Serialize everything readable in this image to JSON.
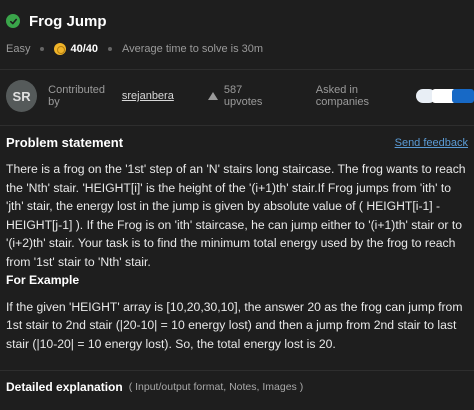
{
  "problem": {
    "title": "Frog Jump",
    "difficulty": "Easy",
    "score": "40/40",
    "avg_time": "Average time to solve is 30m"
  },
  "contributor": {
    "avatar_initials": "SR",
    "label": "Contributed by",
    "username": "srejanbera",
    "upvotes": "587 upvotes",
    "companies_label": "Asked in companies"
  },
  "statement": {
    "heading": "Problem statement",
    "feedback_link": "Send feedback",
    "body": "There is a frog on the '1st' step of an 'N' stairs long staircase. The frog wants to reach the 'Nth' stair. 'HEIGHT[i]' is the height of the '(i+1)th' stair.If Frog jumps from 'ith' to 'jth' stair, the energy lost in the jump is given by absolute value of ( HEIGHT[i-1] - HEIGHT[j-1] ). If the Frog is on 'ith' staircase, he can jump either to '(i+1)th' stair or to '(i+2)th' stair. Your task is to find the minimum total energy used by the frog to reach from '1st' stair to 'Nth' stair.",
    "example_heading": "For Example",
    "example_body": "If the given 'HEIGHT' array is [10,20,30,10], the answer 20 as the frog can jump from 1st stair to 2nd stair (|20-10| = 10 energy lost) and then a jump from 2nd stair to last stair (|10-20| = 10 energy lost). So, the total energy lost is 20."
  },
  "detailed": {
    "title": "Detailed explanation",
    "subtitle": "( Input/output format, Notes, Images )"
  },
  "colors": {
    "background": "#1e1e1e",
    "success": "#3aa54a",
    "coin": "#f0b429",
    "link": "#5b9bd5"
  }
}
